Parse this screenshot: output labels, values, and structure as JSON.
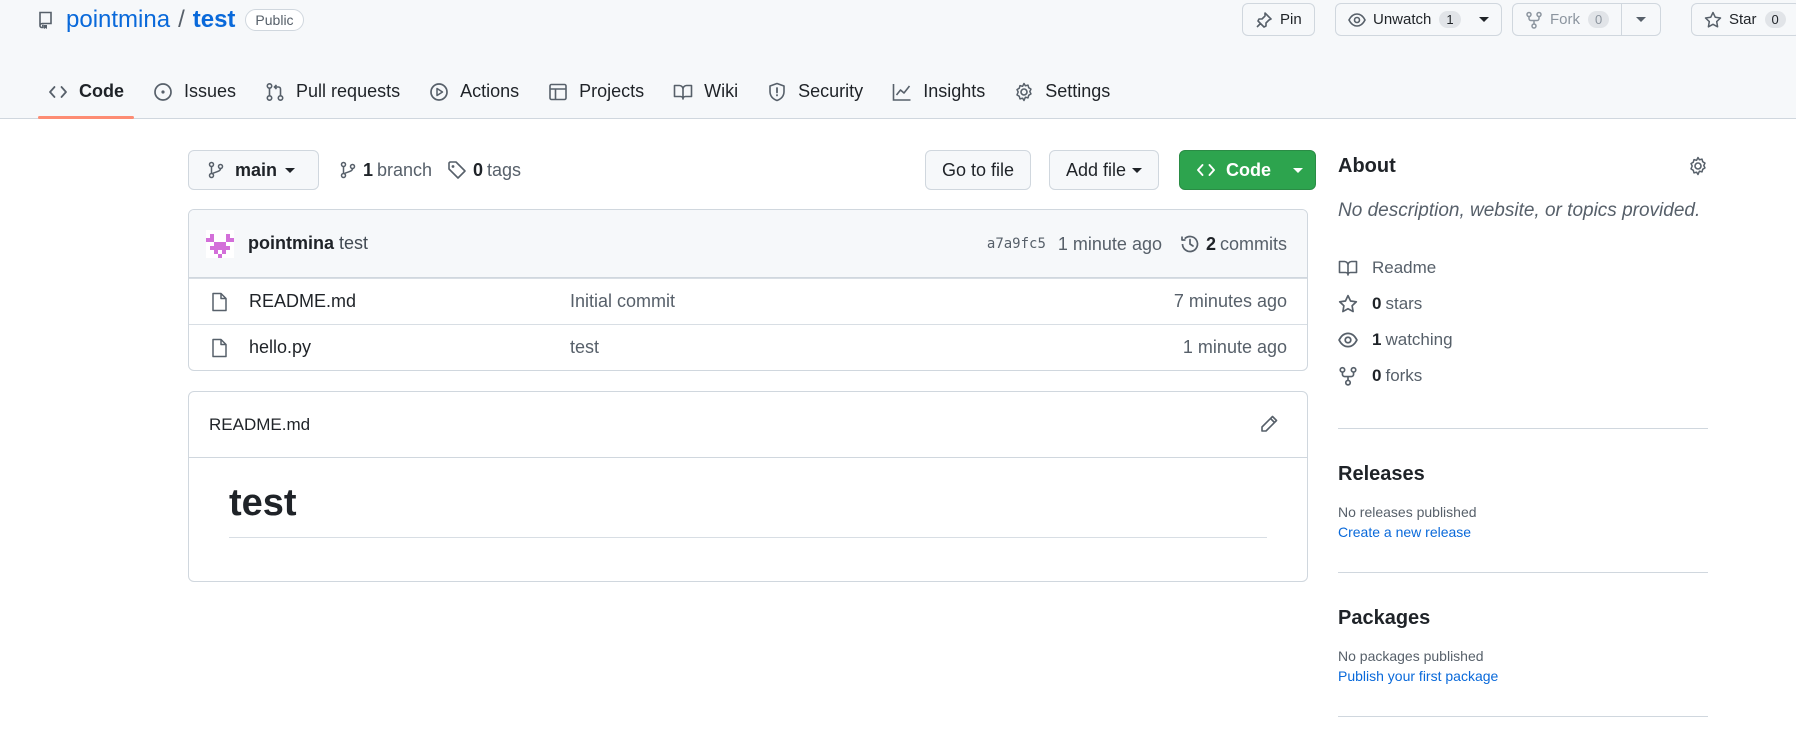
{
  "repo": {
    "owner": "pointmina",
    "separator": "/",
    "name": "test",
    "visibility": "Public"
  },
  "header_actions": {
    "pin": "Pin",
    "unwatch": "Unwatch",
    "unwatch_count": "1",
    "fork": "Fork",
    "fork_count": "0",
    "star": "Star",
    "star_count": "0"
  },
  "tabs": [
    {
      "label": "Code",
      "icon": "code-icon",
      "active": true
    },
    {
      "label": "Issues",
      "icon": "issue-icon"
    },
    {
      "label": "Pull requests",
      "icon": "pull-request-icon"
    },
    {
      "label": "Actions",
      "icon": "play-icon"
    },
    {
      "label": "Projects",
      "icon": "table-icon"
    },
    {
      "label": "Wiki",
      "icon": "book-icon"
    },
    {
      "label": "Security",
      "icon": "shield-icon"
    },
    {
      "label": "Insights",
      "icon": "graph-icon"
    },
    {
      "label": "Settings",
      "icon": "gear-icon"
    }
  ],
  "branch_bar": {
    "branch": "main",
    "branch_count": "1",
    "branch_label": "branch",
    "tag_count": "0",
    "tag_label": "tags",
    "goto_file": "Go to file",
    "add_file": "Add file",
    "code": "Code"
  },
  "latest_commit": {
    "author": "pointmina",
    "message": "test",
    "sha": "a7a9fc5",
    "age": "1 minute ago",
    "commit_count": "2",
    "commit_label": "commits"
  },
  "files": [
    {
      "name": "README.md",
      "commit": "Initial commit",
      "age": "7 minutes ago"
    },
    {
      "name": "hello.py",
      "commit": "test",
      "age": "1 minute ago"
    }
  ],
  "readme": {
    "filename": "README.md",
    "heading": "test"
  },
  "about": {
    "title": "About",
    "description": "No description, website, or topics provided.",
    "readme": "Readme",
    "stars_count": "0",
    "stars_label": "stars",
    "watching_count": "1",
    "watching_label": "watching",
    "forks_count": "0",
    "forks_label": "forks"
  },
  "releases": {
    "title": "Releases",
    "none": "No releases published",
    "create": "Create a new release"
  },
  "packages": {
    "title": "Packages",
    "none": "No packages published",
    "publish": "Publish your first package"
  },
  "colors": {
    "link": "#0969da",
    "code_button": "#2da44e",
    "active_tab_underline": "#fd8c73",
    "border": "#d0d7de"
  }
}
